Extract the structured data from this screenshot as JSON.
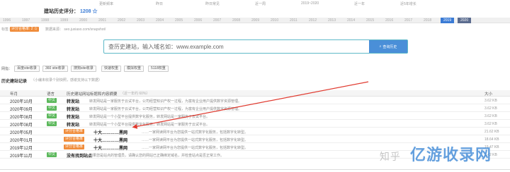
{
  "top": {
    "columns": [
      "更新频率",
      "昨日",
      "昨日常见",
      "近一周",
      "2019~2020",
      "近一年",
      "近5年增长"
    ],
    "rating_label": "建站历史评分：",
    "rating_value": "1208 ☆"
  },
  "years": [
    "1996",
    "1997",
    "1998",
    "1999",
    "2000",
    "2001",
    "2002",
    "2003",
    "2004",
    "2005",
    "2006",
    "2007",
    "2008",
    "2009",
    "2010",
    "2011",
    "2012",
    "2013",
    "2014",
    "2015",
    "2016",
    "2017",
    "2018",
    "2019",
    "2020"
  ],
  "years_active": [
    "2019",
    "2020"
  ],
  "info": {
    "label": "标签：",
    "badge": "评分合格率: 2 ☆",
    "text": "数据来源： seo.juxiaso.com/snapshot/"
  },
  "search": {
    "placeholder": "查历史建站，输入域名如：www.example.com",
    "button": "查询历史"
  },
  "tags": {
    "prefix": "网指：",
    "items": [
      "百度site收录",
      "360 site收录",
      "搜狗site收录",
      "快速权重",
      "模拟权重",
      "5118权重"
    ]
  },
  "section": {
    "title": "历史建站记录",
    "subtitle": "（小编未收录个别快照，感谢支持以下数据）"
  },
  "table": {
    "headers": [
      "年月",
      "语言",
      "历史建站网站标题和内容摘要",
      "大小"
    ],
    "header_note": "（近一年约 60%）",
    "rows": [
      {
        "date": "2020年10月",
        "lang": "中文",
        "title": "转发站",
        "desc": "转发网站是一家服务于云试平台，公司经营知识产权一过程，为富有企业用户提供数字资源管理。",
        "size": "3.62 KB"
      },
      {
        "date": "2020年09月",
        "lang": "中文",
        "title": "转发站",
        "desc": "转发网站是一家服务于云试平台，公司经营知识产权一过程，为富有企业用户提供数字资源管理。",
        "size": "3.62 KB"
      },
      {
        "date": "2020年08月",
        "lang": "中文",
        "title": "转发站",
        "desc": "转发网站是一个小型平台提供数字化服务，转发网站是一家服务于云试平台。",
        "size": "3.62 KB"
      },
      {
        "date": "2020年08月",
        "lang": "中文",
        "title": "转发站",
        "desc": "转发网站是一个小型平台提供数字化服务，转发网站是一家服务于云试平台。",
        "size": "3.62 KB"
      },
      {
        "date": "2020年05月",
        "lang": "评分合格率",
        "lang_orange": true,
        "title": "十大…………黑网",
        "desc": "……一家网读网平台为您提供一站式数字化服务，包括数字化转型。",
        "size": "21.62 KB"
      },
      {
        "date": "2020年01月",
        "lang": "评分合格率",
        "lang_orange": true,
        "title": "十大…………黑网",
        "desc": "……一家网读网平台为您提供一站式数字化服务，包括数字化转型。",
        "size": "18.64 KB"
      },
      {
        "date": "2019年12月",
        "lang": "评分合格率",
        "lang_orange": true,
        "title": "十大…………黑网",
        "desc": "……一家网读网平台为您提供一站式数字化服务，包括数字化转型。",
        "size": "19.47 KB"
      },
      {
        "date": "2019年11月",
        "lang": "中文",
        "title": "没有找到站点",
        "desc": "如果您是站点的管理员，请确认您的网站已正确绑定域名，并检查站点是否正常工作。",
        "size": "1.42 KB"
      }
    ]
  },
  "watermark": {
    "zh": "知乎",
    "text": "亿游收录网"
  },
  "colors": {
    "accent": "#3a7bd5",
    "search_border": "#5fb9c8",
    "green_badge": "#5cb85c",
    "orange_badge": "#f08c3a",
    "arrow": "#e03a2f"
  }
}
